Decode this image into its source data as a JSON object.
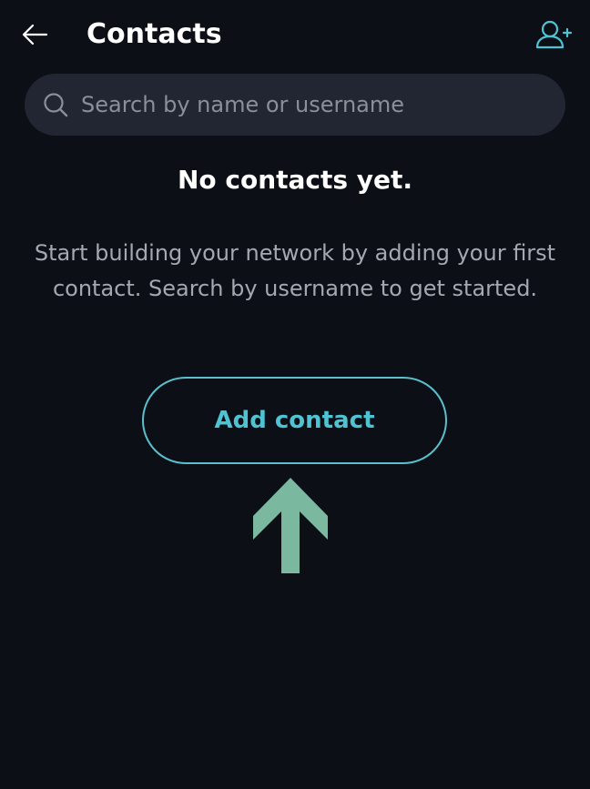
{
  "header": {
    "title": "Contacts"
  },
  "search": {
    "placeholder": "Search by name or username",
    "value": ""
  },
  "empty_state": {
    "title": "No contacts yet.",
    "description": "Start building your network by adding your first contact. Search by username to get started.",
    "button_label": "Add contact"
  },
  "colors": {
    "background": "#0c0f16",
    "accent": "#4fc3d2",
    "arrow": "#7ab8a0"
  }
}
